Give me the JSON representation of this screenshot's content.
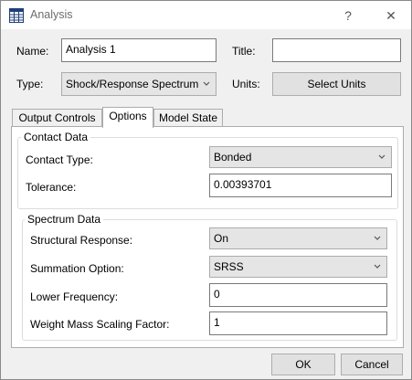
{
  "window": {
    "title": "Analysis",
    "help_glyph": "?",
    "close_glyph": "✕"
  },
  "form": {
    "name_label": "Name:",
    "name_value": "Analysis 1",
    "title_label": "Title:",
    "title_value": "",
    "type_label": "Type:",
    "type_value": "Shock/Response Spectrum",
    "units_label": "Units:",
    "units_button": "Select Units"
  },
  "tabs": [
    {
      "label": "Output Controls",
      "active": false
    },
    {
      "label": "Options",
      "active": true
    },
    {
      "label": "Model State",
      "active": false
    }
  ],
  "contact": {
    "group_title": "Contact Data",
    "contact_type_label": "Contact Type:",
    "contact_type_value": "Bonded",
    "tolerance_label": "Tolerance:",
    "tolerance_value": "0.00393701"
  },
  "spectrum": {
    "group_title": "Spectrum Data",
    "structural_response_label": "Structural Response:",
    "structural_response_value": "On",
    "summation_label": "Summation Option:",
    "summation_value": "SRSS",
    "lower_freq_label": "Lower Frequency:",
    "lower_freq_value": "0",
    "weight_mass_label": "Weight Mass Scaling Factor:",
    "weight_mass_value": "1"
  },
  "footer": {
    "ok_label": "OK",
    "cancel_label": "Cancel"
  },
  "icons": {
    "app": "table-window-icon",
    "dropdown": "chevron-down-icon"
  }
}
